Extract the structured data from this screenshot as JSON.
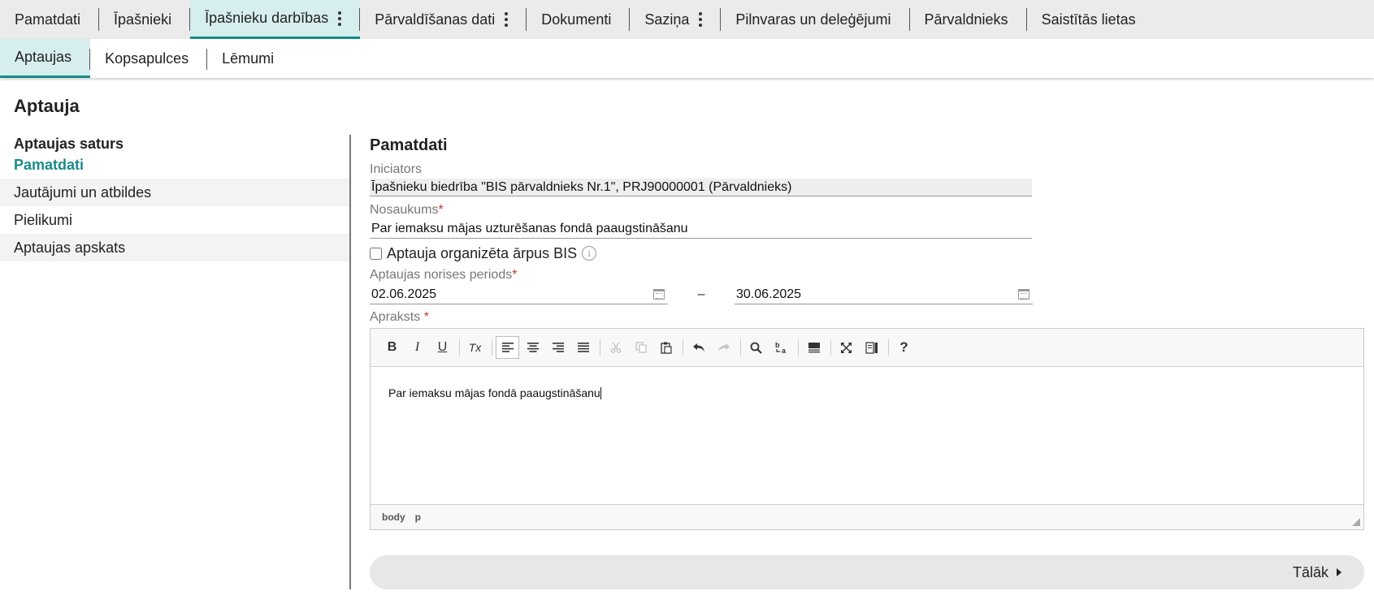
{
  "top_tabs": [
    {
      "label": "Pamatdati"
    },
    {
      "label": "Īpašnieki"
    },
    {
      "label": "Īpašnieku darbības"
    },
    {
      "label": "Pārvaldīšanas dati"
    },
    {
      "label": "Dokumenti"
    },
    {
      "label": "Saziņa"
    },
    {
      "label": "Pilnvaras un deleģējumi"
    },
    {
      "label": "Pārvaldnieks"
    },
    {
      "label": "Saistītās lietas"
    }
  ],
  "sub_tabs": [
    {
      "label": "Aptaujas"
    },
    {
      "label": "Kopsapulces"
    },
    {
      "label": "Lēmumi"
    }
  ],
  "page_title": "Aptauja",
  "left_nav": {
    "heading": "Aptaujas saturs",
    "items": [
      {
        "label": "Pamatdati"
      },
      {
        "label": "Jautājumi un atbildes"
      },
      {
        "label": "Pielikumi"
      },
      {
        "label": "Aptaujas apskats"
      }
    ]
  },
  "form": {
    "section_title": "Pamatdati",
    "initiator_label": "Iniciators",
    "initiator_value": "Īpašnieku biedrība \"BIS pārvaldnieks Nr.1\", PRJ90000001 (Pārvaldnieks)",
    "name_label": "Nosaukums",
    "name_value": "Par iemaksu mājas uzturēšanas fondā paaugstināšanu",
    "required_mark": "*",
    "outside_bis_label": "Aptauja organizēta ārpus BIS",
    "info_glyph": "i",
    "period_label": "Aptaujas norises periods",
    "period_from": "02.06.2025",
    "period_dash": "–",
    "period_to": "30.06.2025",
    "description_label": "Apraksts",
    "description_required_mark": " *",
    "description_text": "Par iemaksu mājas fondā paaugstināšanu"
  },
  "editor": {
    "toolbar": {
      "bold": "B",
      "italic": "I",
      "underline": "U",
      "remove_format": "Tx",
      "help": "?"
    },
    "status_path": [
      "body",
      "p"
    ]
  },
  "next_label": "Tālāk",
  "colors": {
    "accent": "#1a8a8a",
    "active_tab_bg": "#d6eeee",
    "required": "#c0392b"
  }
}
